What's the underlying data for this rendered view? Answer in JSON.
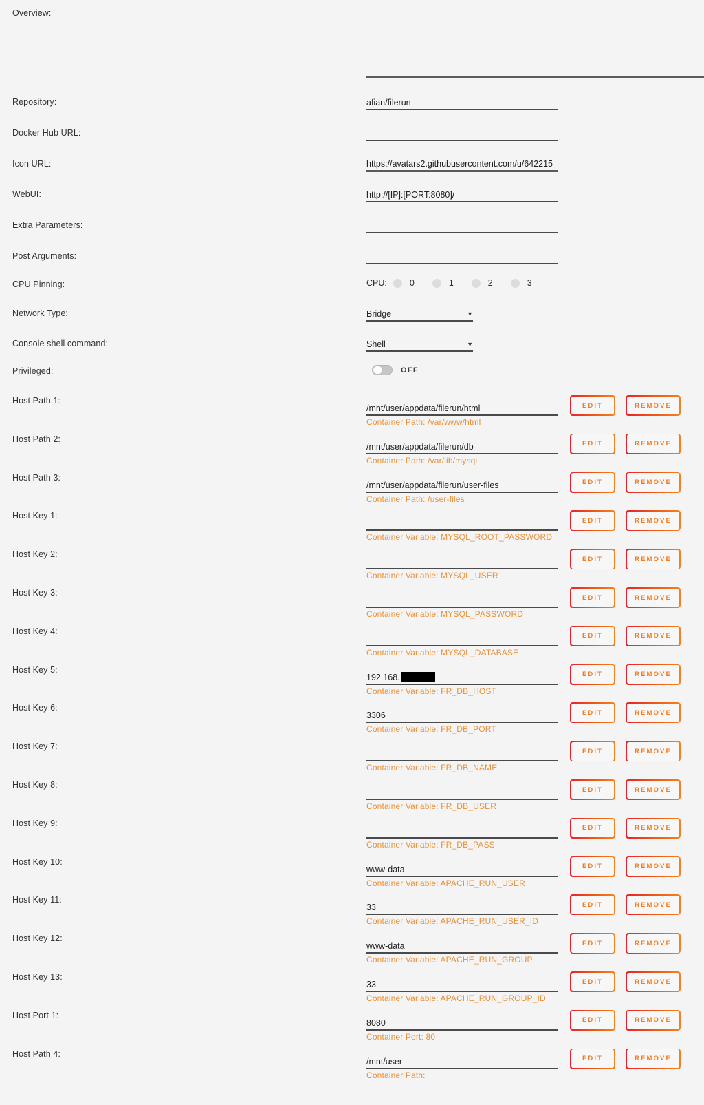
{
  "form": {
    "overview": {
      "label": "Overview:",
      "value": ""
    },
    "repository": {
      "label": "Repository:",
      "value": "afian/filerun"
    },
    "docker_hub_url": {
      "label": "Docker Hub URL:",
      "value": ""
    },
    "icon_url": {
      "label": "Icon URL:",
      "value": "https://avatars2.githubusercontent.com/u/642215"
    },
    "webui": {
      "label": "WebUI:",
      "value": "http://[IP]:[PORT:8080]/"
    },
    "extra_parameters": {
      "label": "Extra Parameters:",
      "value": ""
    },
    "post_arguments": {
      "label": "Post Arguments:",
      "value": ""
    },
    "cpu_pinning": {
      "label": "CPU Pinning:",
      "prefix": "CPU:",
      "options": [
        "0",
        "1",
        "2",
        "3"
      ]
    },
    "network_type": {
      "label": "Network Type:",
      "value": "Bridge"
    },
    "console_shell_command": {
      "label": "Console shell command:",
      "value": "Shell"
    },
    "privileged": {
      "label": "Privileged:",
      "state": "OFF"
    }
  },
  "buttons": {
    "edit": "EDIT",
    "remove": "REMOVE"
  },
  "mappings": [
    {
      "label": "Host Path 1:",
      "value": "/mnt/user/appdata/filerun/html",
      "sub": "Container Path: /var/www/html"
    },
    {
      "label": "Host Path 2:",
      "value": "/mnt/user/appdata/filerun/db",
      "sub": "Container Path: /var/lib/mysql"
    },
    {
      "label": "Host Path 3:",
      "value": "/mnt/user/appdata/filerun/user-files",
      "sub": "Container Path: /user-files"
    },
    {
      "label": "Host Key 1:",
      "value": "",
      "sub": "Container Variable: MYSQL_ROOT_PASSWORD"
    },
    {
      "label": "Host Key 2:",
      "value": "",
      "sub": "Container Variable: MYSQL_USER"
    },
    {
      "label": "Host Key 3:",
      "value": "",
      "sub": "Container Variable: MYSQL_PASSWORD"
    },
    {
      "label": "Host Key 4:",
      "value": "",
      "sub": "Container Variable: MYSQL_DATABASE"
    },
    {
      "label": "Host Key 5:",
      "value": "192.168.",
      "redacted": true,
      "sub": "Container Variable: FR_DB_HOST"
    },
    {
      "label": "Host Key 6:",
      "value": "3306",
      "sub": "Container Variable: FR_DB_PORT"
    },
    {
      "label": "Host Key 7:",
      "value": "",
      "sub": "Container Variable: FR_DB_NAME"
    },
    {
      "label": "Host Key 8:",
      "value": "",
      "sub": "Container Variable: FR_DB_USER"
    },
    {
      "label": "Host Key 9:",
      "value": "",
      "sub": "Container Variable: FR_DB_PASS"
    },
    {
      "label": "Host Key 10:",
      "value": "www-data",
      "sub": "Container Variable: APACHE_RUN_USER"
    },
    {
      "label": "Host Key 11:",
      "value": "33",
      "sub": "Container Variable: APACHE_RUN_USER_ID"
    },
    {
      "label": "Host Key 12:",
      "value": "www-data",
      "sub": "Container Variable: APACHE_RUN_GROUP"
    },
    {
      "label": "Host Key 13:",
      "value": "33",
      "sub": "Container Variable: APACHE_RUN_GROUP_ID"
    },
    {
      "label": "Host Port 1:",
      "value": "8080",
      "sub": "Container Port: 80"
    },
    {
      "label": "Host Path 4:",
      "value": "/mnt/user",
      "sub": "Container Path:"
    }
  ]
}
